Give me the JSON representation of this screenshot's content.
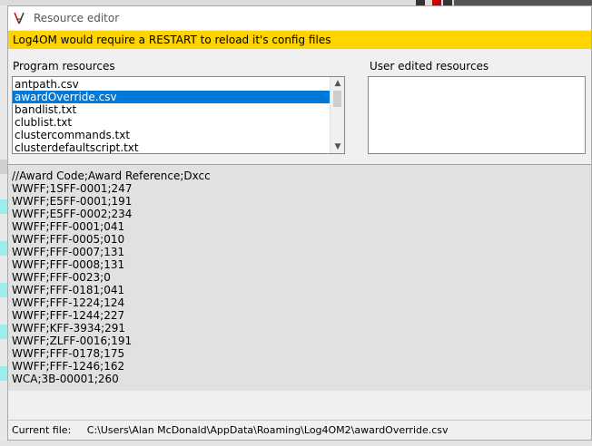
{
  "window": {
    "title": "Resource editor",
    "icon": "app-icon"
  },
  "warning": {
    "text": "Log4OM would require a RESTART to reload it's config files",
    "color": "#ffd400"
  },
  "program_resources": {
    "label": "Program resources",
    "items": [
      {
        "label": "antpath.csv",
        "selected": false
      },
      {
        "label": "awardOverride.csv",
        "selected": true
      },
      {
        "label": "bandlist.txt",
        "selected": false
      },
      {
        "label": "clublist.txt",
        "selected": false
      },
      {
        "label": "clustercommands.txt",
        "selected": false
      },
      {
        "label": "clusterdefaultscript.txt",
        "selected": false
      }
    ]
  },
  "user_resources": {
    "label": "User edited resources",
    "items": []
  },
  "editor": {
    "lines": [
      "//Award Code;Award Reference;Dxcc",
      "WWFF;1SFF-0001;247",
      "WWFF;E5FF-0001;191",
      "WWFF;E5FF-0002;234",
      "WWFF;FFF-0001;041",
      "WWFF;FFF-0005;010",
      "WWFF;FFF-0007;131",
      "WWFF;FFF-0008;131",
      "WWFF;FFF-0023;0",
      "WWFF;FFF-0181;041",
      "WWFF;FFF-1224;124",
      "WWFF;FFF-1244;227",
      "WWFF;KFF-3934;291",
      "WWFF;ZLFF-0016;191",
      "WWFF;FFF-0178;175",
      "WWFF;FFF-1246;162",
      "WCA;3B-00001;260"
    ]
  },
  "status": {
    "label": "Current file:",
    "path": "C:\\Users\\Alan McDonald\\AppData\\Roaming\\Log4OM2\\awardOverride.csv"
  },
  "colors": {
    "selection": "#0078d7",
    "editor_bg": "#e1e1e1"
  }
}
